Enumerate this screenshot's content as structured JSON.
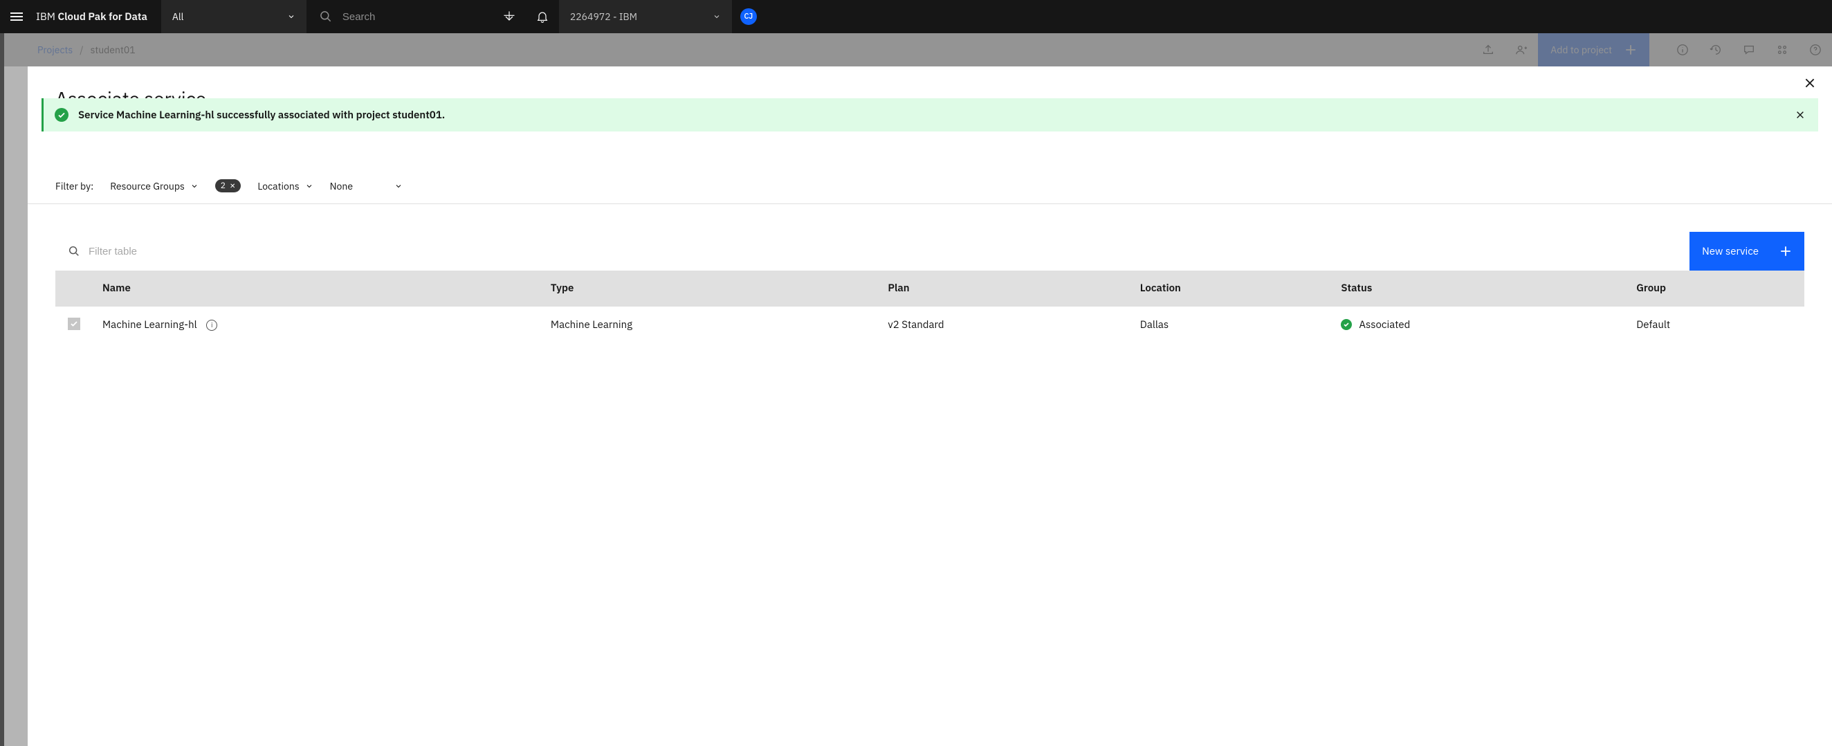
{
  "navbar": {
    "brand_prefix": "IBM ",
    "brand_main": "Cloud Pak for Data",
    "dropdown_label": "All",
    "search_placeholder": "Search",
    "account_label": "2264972 - IBM",
    "avatar_initials": "CJ"
  },
  "breadcrumb": {
    "root": "Projects",
    "separator": "/",
    "current": "student01"
  },
  "subheader": {
    "add_to_project": "Add to project"
  },
  "modal": {
    "title": "Associate service"
  },
  "toast": {
    "message": "Service Machine Learning-hl successfully associated with project student01."
  },
  "filters": {
    "label": "Filter by:",
    "resource_groups": "Resource Groups",
    "tag_count": "2",
    "locations": "Locations",
    "none": "None"
  },
  "table": {
    "filter_placeholder": "Filter table",
    "new_service_label": "New service",
    "columns": {
      "name": "Name",
      "type": "Type",
      "plan": "Plan",
      "location": "Location",
      "status": "Status",
      "group": "Group"
    },
    "rows": [
      {
        "name": "Machine Learning-hl",
        "type": "Machine Learning",
        "plan": "v2 Standard",
        "location": "Dallas",
        "status": "Associated",
        "group": "Default"
      }
    ]
  }
}
